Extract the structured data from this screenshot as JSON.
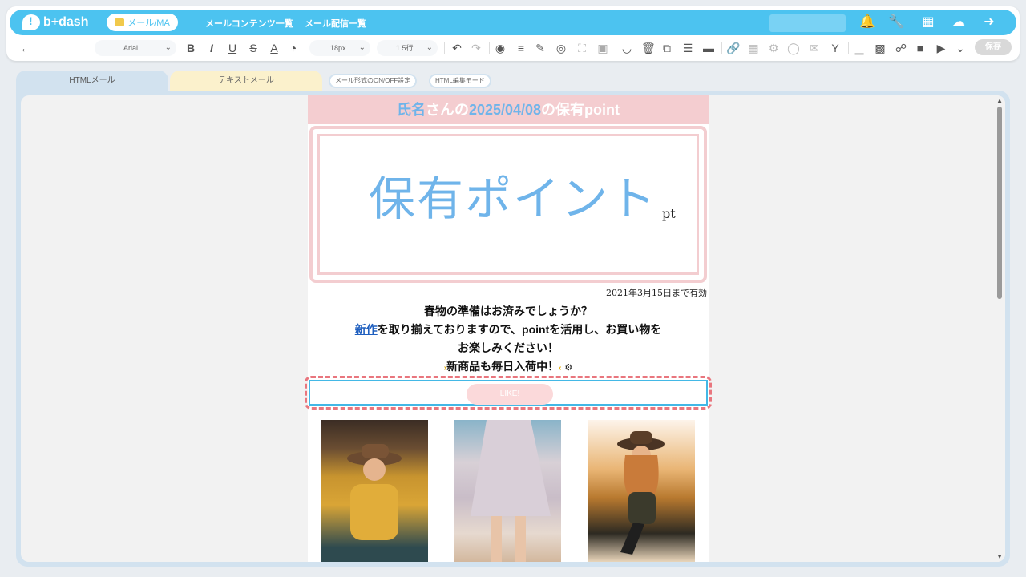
{
  "nav": {
    "logo_text": "b+dash",
    "active_pill": "メール/MA",
    "links": [
      "メールコンテンツ一覧",
      "メール配信一覧"
    ]
  },
  "toolbar": {
    "font_family": "Arial",
    "font_size": "18px",
    "line_height": "1.5行",
    "save_label": "保存"
  },
  "tabs": {
    "html": "HTMLメール",
    "text": "テキストメール",
    "format_toggle": "メール形式のON/OFF設定",
    "html_edit_mode": "HTML編集モード"
  },
  "email": {
    "header_pre": "氏名",
    "header_mid1": "さんの",
    "header_date": "2025/04/08",
    "header_mid2": "の保有",
    "header_post": "point",
    "points_label": "保有ポイント",
    "points_unit": "pt",
    "valid_until": "2021年3月15日まで有効",
    "line1": "春物の準備はお済みでしょうか？",
    "line2_link": "新作",
    "line2_rest": "を取り揃えておりますので、pointを活用し、お買い物を",
    "line3": "お楽しみください！",
    "line4": "新商品も毎日入荷中！",
    "like_button": "LIKE!"
  },
  "colors": {
    "accent": "#4cc3f0",
    "pink": "#f4cdd0",
    "blue_text": "#6fb4ea",
    "selection": "#e9767e"
  }
}
